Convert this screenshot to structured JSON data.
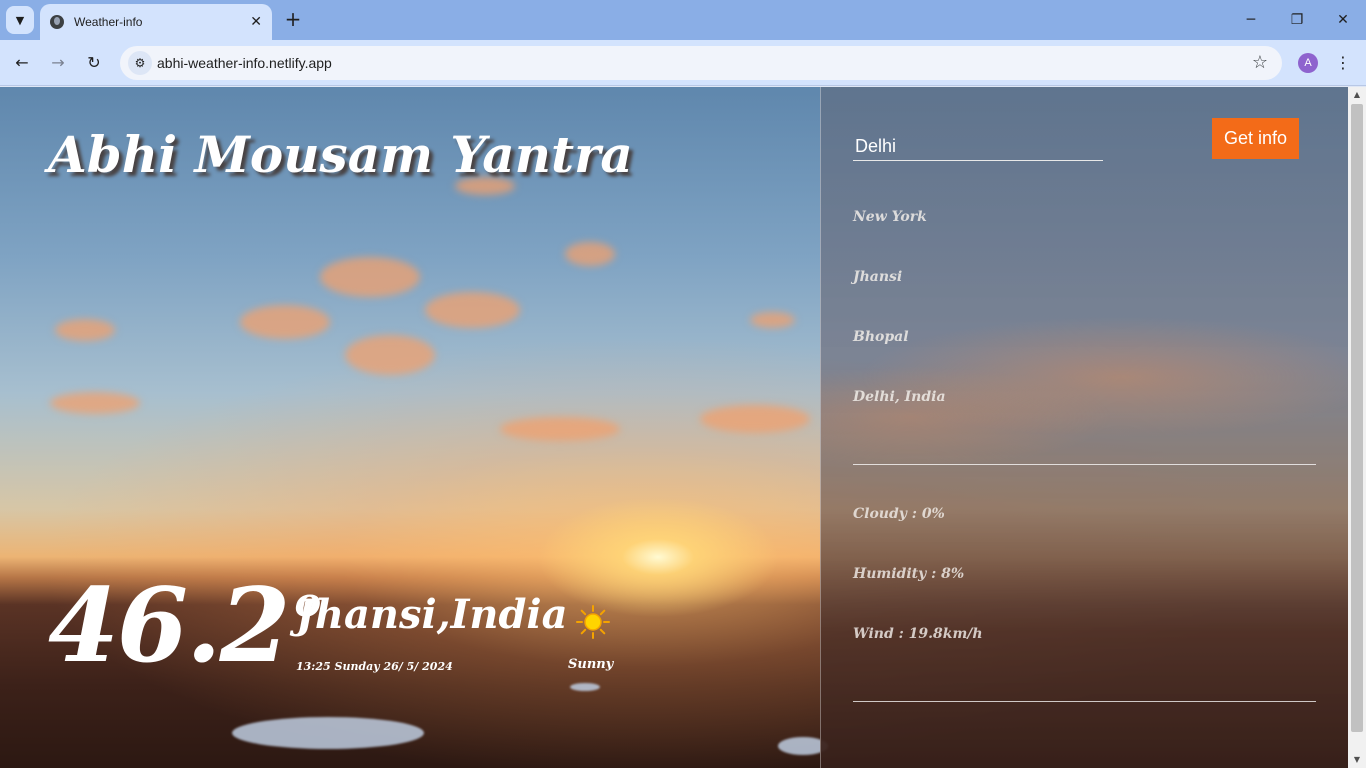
{
  "browser": {
    "tab_title": "Weather-info",
    "url": "abhi-weather-info.netlify.app",
    "profile_initial": "A"
  },
  "app": {
    "title": "Abhi Mousam Yantra",
    "temperature": "46.2",
    "degree_symbol": "o",
    "location": "Jhansi,India",
    "datetime": "13:25 Sunday 26/ 5/ 2024",
    "condition": "Sunny",
    "condition_icon": "sun-icon"
  },
  "panel": {
    "search_value": "Delhi",
    "get_info_label": "Get info",
    "locations": [
      "New York",
      "Jhansi",
      "Bhopal",
      "Delhi, India"
    ],
    "details": {
      "cloudy": "Cloudy : 0%",
      "humidity": "Humidity : 8%",
      "wind": "Wind : 19.8km/h"
    }
  },
  "colors": {
    "accent_button": "#f36b18",
    "chrome": "#d3e3fd"
  }
}
